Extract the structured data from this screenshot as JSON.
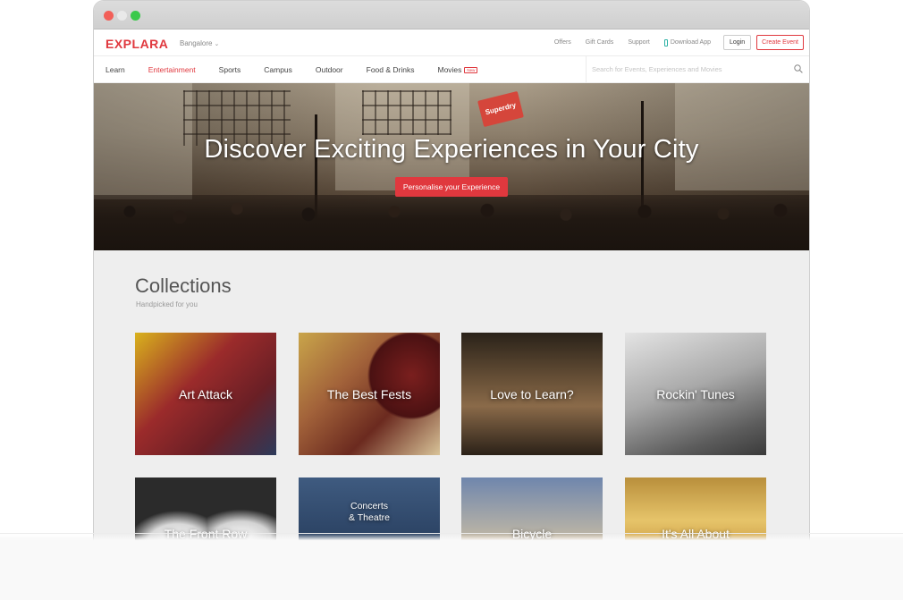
{
  "browser": {
    "controls": [
      "close",
      "minimize",
      "maximize"
    ]
  },
  "header": {
    "logo": "EXPLARA",
    "city": "Bangalore",
    "links": {
      "offers": "Offers",
      "gift_cards": "Gift Cards",
      "support": "Support",
      "download_app": "Download App"
    },
    "login": "Login",
    "create_event": "Create Event"
  },
  "nav": {
    "items": [
      {
        "label": "Learn",
        "active": false
      },
      {
        "label": "Entertainment",
        "active": true
      },
      {
        "label": "Sports",
        "active": false
      },
      {
        "label": "Campus",
        "active": false
      },
      {
        "label": "Outdoor",
        "active": false
      },
      {
        "label": "Food & Drinks",
        "active": false
      },
      {
        "label": "Movies",
        "active": false,
        "badge": "New"
      }
    ],
    "search_placeholder": "Search for Events, Experiences and Movies"
  },
  "hero": {
    "title": "Discover Exciting Experiences in Your City",
    "cta": "Personalise your Experience",
    "sign_text": "Superdry"
  },
  "collections": {
    "title": "Collections",
    "subtitle": "Handpicked for you",
    "tiles": [
      {
        "label": "Art Attack"
      },
      {
        "label": "The Best Fests"
      },
      {
        "label": "Love to Learn?"
      },
      {
        "label": "Rockin' Tunes"
      },
      {
        "label": "The Front Row"
      },
      {
        "label": "Concerts & Theatre"
      },
      {
        "label": "Bicycle"
      },
      {
        "label": "It's All About"
      }
    ]
  },
  "colors": {
    "brand": "#e0383e",
    "accent_teal": "#2bb1a4"
  }
}
